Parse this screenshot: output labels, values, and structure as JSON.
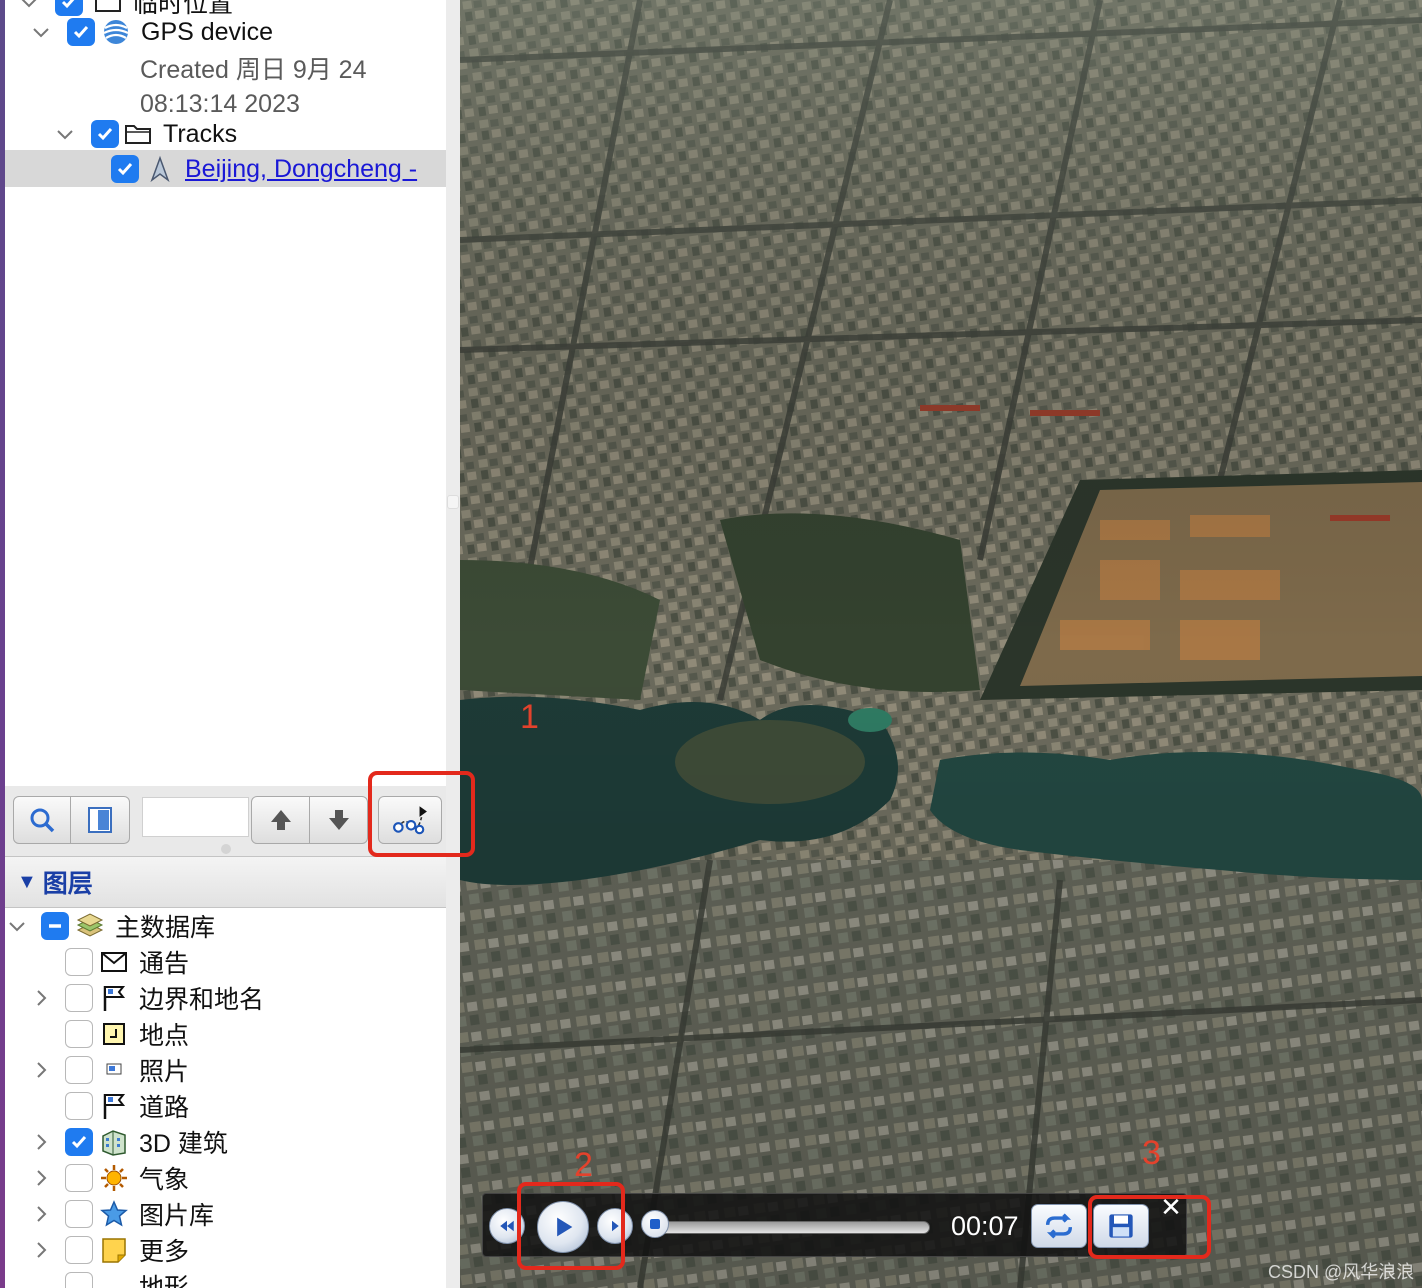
{
  "places": {
    "top_partial_label": "临时位置",
    "gps_label": "GPS device",
    "gps_sub_line1": "Created 周日 9月 24",
    "gps_sub_line2": "08:13:14 2023",
    "tracks_label": "Tracks",
    "track_item_label": "Beijing, Dongcheng -"
  },
  "toolbar": {
    "search_value": ""
  },
  "layers": {
    "header": "图层",
    "root_label": "主数据库",
    "items": [
      {
        "label": "通告",
        "checked": false,
        "expandable": false,
        "icon": "envelope-icon"
      },
      {
        "label": "边界和地名",
        "checked": false,
        "expandable": true,
        "icon": "flag-icon"
      },
      {
        "label": "地点",
        "checked": false,
        "expandable": false,
        "icon": "place-icon"
      },
      {
        "label": "照片",
        "checked": false,
        "expandable": true,
        "icon": "photo-icon"
      },
      {
        "label": "道路",
        "checked": false,
        "expandable": false,
        "icon": "road-flag-icon"
      },
      {
        "label": "3D 建筑",
        "checked": true,
        "expandable": true,
        "icon": "building-icon"
      },
      {
        "label": "气象",
        "checked": false,
        "expandable": true,
        "icon": "sun-icon"
      },
      {
        "label": "图片库",
        "checked": false,
        "expandable": true,
        "icon": "star-icon"
      },
      {
        "label": "更多",
        "checked": false,
        "expandable": true,
        "icon": "note-icon"
      },
      {
        "label": "地形",
        "checked": false,
        "expandable": false,
        "icon": ""
      }
    ]
  },
  "player": {
    "time": "00:07",
    "progress": 0.0
  },
  "annotations": {
    "n1": "1",
    "n2": "2",
    "n3": "3"
  },
  "watermark": "CSDN @风华浪浪",
  "colors": {
    "checkbox_on": "#1f7bf0",
    "link": "#1a18d6",
    "annotation_red": "#e3291c",
    "layers_header_text": "#1a3fa6"
  }
}
